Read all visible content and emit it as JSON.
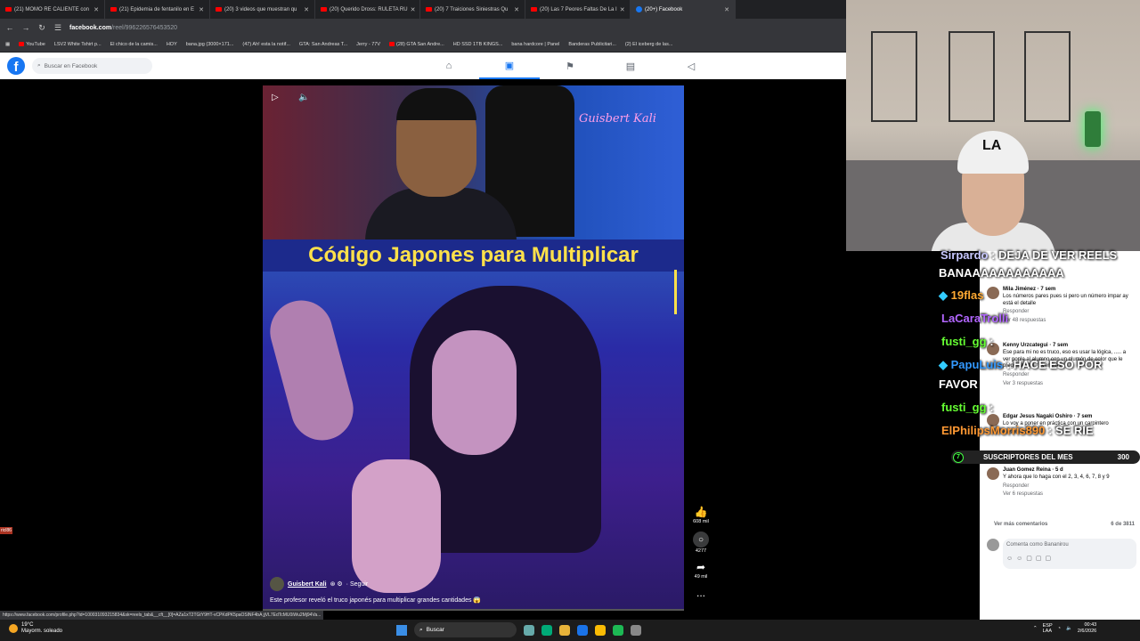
{
  "browser": {
    "tabs": [
      {
        "title": "(21) MOMO RE CALIENTE con",
        "icon": "youtube"
      },
      {
        "title": "(21) Epidemia de fentanilo en E",
        "icon": "youtube"
      },
      {
        "title": "(20) 3 videos que muestran qu",
        "icon": "youtube"
      },
      {
        "title": "(20) Querido Dross: RULETA RU",
        "icon": "youtube"
      },
      {
        "title": "(20) 7 Traiciones Siniestras Qu",
        "icon": "youtube"
      },
      {
        "title": "(20) Las 7 Peores Faltas De La I",
        "icon": "youtube"
      },
      {
        "title": "(20+) Facebook",
        "icon": "facebook",
        "active": true
      }
    ],
    "url_host": "facebook.com",
    "url_path": "/reel/996226576453520",
    "bookmarks": [
      "YouTube",
      "LSV2 White Tshirt p...",
      "El chico de la camis...",
      "HOY",
      "bana.jpg (3000×171...",
      "(47) Ah! esta la notif...",
      "GTA: San Andreas T...",
      "Jerry - 77V",
      "(28) GTA San Andre...",
      "HD SSD 1TB KINGS...",
      "bana hardcore | Panel",
      "Banderas Publicitari...",
      "(2) El iceberg de las..."
    ]
  },
  "facebook": {
    "logo": "f",
    "search_placeholder": "Buscar en Facebook"
  },
  "reel": {
    "title_text": "Código Japones para Multiplicar",
    "neon_sign": "Guisbert Kali",
    "author": "Guisbert Kali",
    "follow": "· Seguir",
    "caption": "Este profesor reveló el truco japonés para multiplicar grandes cantidades 😱",
    "likes": "608 mil",
    "comments": "4277",
    "shares": "49 mil",
    "more": "..."
  },
  "status_url": "https://www.facebook.com/profile.php?id=100031093215834&sk=reels_tab&__cft__[0]=AZa1xT2TGtY9HT-vCPKdPK5paOSlNF4bA jjVL7EdTcMU0iWu2Mj94Va...",
  "left_tag": "ricl86",
  "chat": [
    {
      "user": "Sirpardo",
      "msg": ": DEJA DE VER REELS",
      "color": "#c8c8ff"
    },
    {
      "user": "",
      "msg": "BANAAAAAAAAAAAA",
      "color": "#ffffff"
    },
    {
      "user": "19flas",
      "msg": "",
      "color": "#ffaa33"
    },
    {
      "user": "LaCaraTrolli",
      "msg": "",
      "color": "#b266ff"
    },
    {
      "user": "fusti_gg",
      "msg": ":",
      "color": "#66ff33"
    },
    {
      "user": "PapuLuis",
      "msg": ": HACE ESO POR",
      "color": "#3399ff"
    },
    {
      "user": "",
      "msg": "FAVOR",
      "color": "#ffffff"
    },
    {
      "user": "fusti_gg",
      "msg": ":",
      "color": "#66ff33"
    },
    {
      "user": "ElPhilipsMorris890",
      "msg": ": SE RIE",
      "color": "#ff9933"
    }
  ],
  "subs_bar": {
    "count_icon": "7",
    "label": "SUSCRIPTORES DEL MES",
    "value": "300"
  },
  "fb_comments": [
    {
      "name": "Mila Jiménez · 7 sem",
      "text": "Los números pares pues si pero un número impar ay está el detalle",
      "meta": "Responder",
      "replies": "Ver 48 respuestas"
    },
    {
      "name": "Kenny Urzcategui · 7 sem",
      "text": "Ese para mi no es truco, eso es usar la lógica, ..... a ver ponle al alumno con un plumón de color que le preguntan tal ... Ver más",
      "meta": "Responder",
      "replies": "Ver 3 respuestas"
    },
    {
      "name": "Edgar Jesus Nagaki Oshiro · 7 sem",
      "text": "Lo voy a poner en práctica con un carpintero",
      "meta": "Responder",
      "replies": ""
    },
    {
      "name": "Juan Gomez Reina · 5 d",
      "text": "Y ahora que lo haga con el 2, 3, 4, 6, 7, 8 y 9",
      "meta": "Responder",
      "replies": "Ver 6 respuestas"
    }
  ],
  "more_comments": "Ver más comentarios",
  "comments_count": "6 de 3811",
  "comment_placeholder": "Comenta como Bananirou",
  "taskbar": {
    "temp": "19°C",
    "weather": "Mayorm. soleado",
    "search": "Buscar",
    "lang": "ESP",
    "lang2": "LAA",
    "time": "00:43",
    "date": "2/6/2026"
  }
}
